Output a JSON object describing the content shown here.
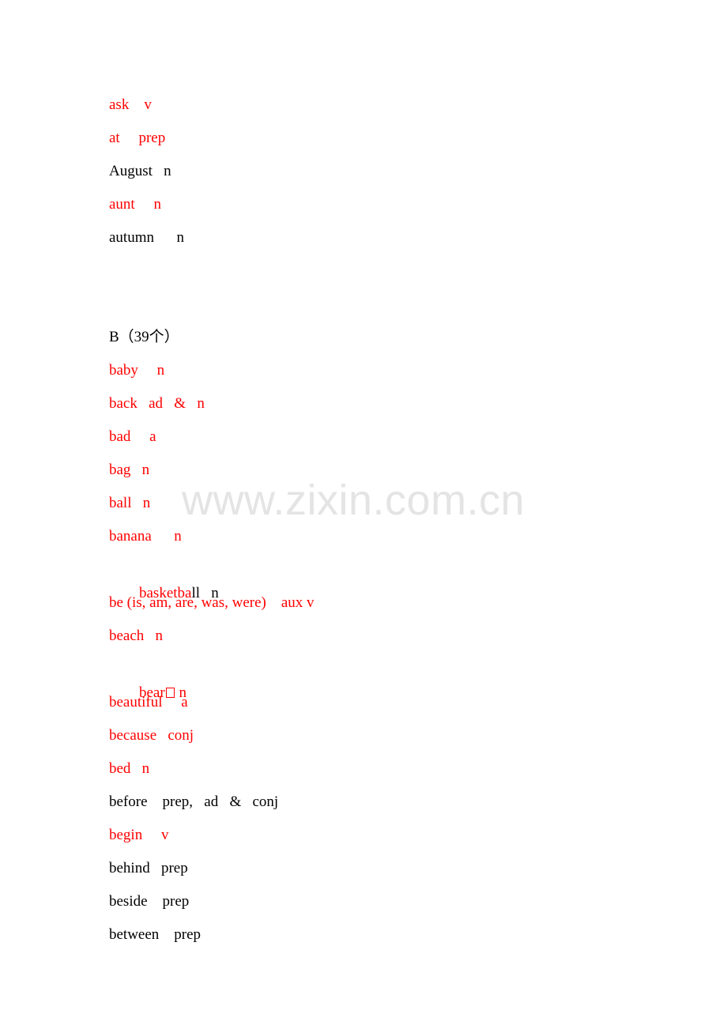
{
  "page": {
    "background_color": "#ffffff",
    "red_color": "#ff0000",
    "black_color": "#000000",
    "watermark_color": "#e4e4e4"
  },
  "watermark": {
    "text": "www.zixin.com.cn"
  },
  "document": {
    "group_a_tail": [
      {
        "word": "ask",
        "pos": "v",
        "color": "red",
        "text": "ask    v"
      },
      {
        "word": "at",
        "pos": "prep",
        "color": "red",
        "text": "at     prep"
      },
      {
        "word": "August",
        "pos": "n",
        "color": "black",
        "text": "August   n"
      },
      {
        "word": "aunt",
        "pos": "n",
        "color": "red",
        "text": "aunt     n"
      },
      {
        "word": "autumn",
        "pos": "n",
        "color": "black",
        "text": "autumn      n"
      }
    ],
    "section_b": {
      "letter": "B",
      "count_label": "（39个）",
      "heading": "B（39个）",
      "entries": [
        {
          "word": "baby",
          "pos": "n",
          "color": "red",
          "text": "baby     n"
        },
        {
          "word": "back",
          "pos": "ad & n",
          "color": "red",
          "text": "back   ad   &   n"
        },
        {
          "word": "bad",
          "pos": "a",
          "color": "red",
          "text": "bad     a"
        },
        {
          "word": "bag",
          "pos": "n",
          "color": "red",
          "text": "bag   n"
        },
        {
          "word": "ball",
          "pos": "n",
          "color": "red",
          "text": "ball   n"
        },
        {
          "word": "banana",
          "pos": "n",
          "color": "red",
          "text": "banana      n"
        },
        {
          "word": "basketball",
          "pos": "n",
          "color": "mixed",
          "text": "basketball   n",
          "segments": [
            {
              "text": "basketba",
              "color": "red"
            },
            {
              "text": "ll",
              "color": "black"
            },
            {
              "text": "   n",
              "color": "black"
            }
          ]
        },
        {
          "word": "be (is, am, are, was, were)",
          "pos": "aux v",
          "color": "red",
          "text": "be (is, am, are, was, were)    aux v"
        },
        {
          "word": "beach",
          "pos": "n",
          "color": "red",
          "text": "beach   n"
        },
        {
          "word": "bear",
          "pos": "n",
          "color": "red",
          "text": "bear□ n",
          "has_tofu": true
        },
        {
          "word": "beautiful",
          "pos": "a",
          "color": "red",
          "text": "beautiful     a"
        },
        {
          "word": "because",
          "pos": "conj",
          "color": "red",
          "text": "because   conj"
        },
        {
          "word": "bed",
          "pos": "n",
          "color": "red",
          "text": "bed   n"
        },
        {
          "word": "before",
          "pos": "prep, ad & conj",
          "color": "black",
          "text": "before    prep,   ad   &   conj"
        },
        {
          "word": "begin",
          "pos": "v",
          "color": "red",
          "text": "begin     v"
        },
        {
          "word": "behind",
          "pos": "prep",
          "color": "black",
          "text": "behind   prep"
        },
        {
          "word": "beside",
          "pos": "prep",
          "color": "black",
          "text": "beside    prep"
        },
        {
          "word": "between",
          "pos": "prep",
          "color": "black",
          "text": "between    prep"
        }
      ]
    }
  }
}
